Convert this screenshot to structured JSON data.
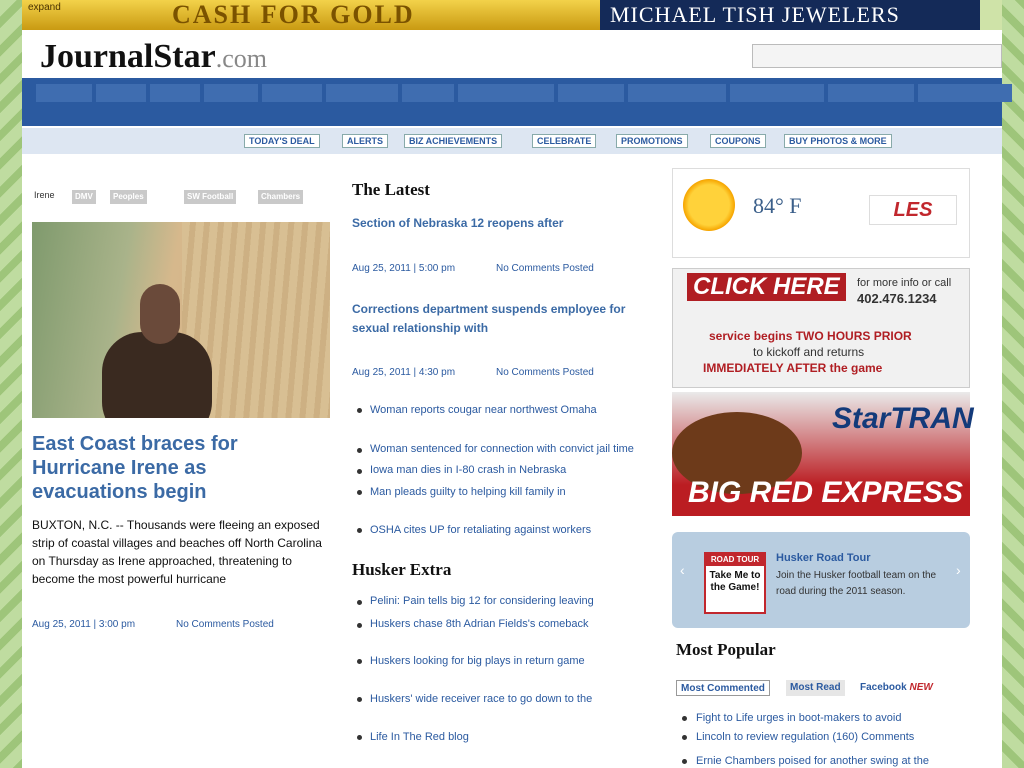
{
  "banner": {
    "expand": "expand",
    "ad_text": "CASH FOR GOLD",
    "jeweler": "MICHAEL TISH JEWELERS"
  },
  "logo": {
    "main": "JournalStar",
    "suffix": ".com"
  },
  "nav_sub": [
    "TODAY'S DEAL",
    "ALERTS",
    "BIZ ACHIEVEMENTS",
    "CELEBRATE",
    "PROMOTIONS",
    "COUPONS",
    "BUY PHOTOS & MORE"
  ],
  "tags": [
    "Irene",
    "DMV",
    "Peoples",
    "SW Football",
    "Chambers"
  ],
  "main_story": {
    "headline": "East Coast braces for Hurricane Irene as evacuations begin",
    "body": "BUXTON, N.C. -- Thousands were fleeing an exposed strip of coastal villages and beaches off North Carolina on Thursday as Irene approached, threatening to become the most powerful hurricane",
    "date": "Aug 25, 2011 | 3:00 pm",
    "comments": "No Comments Posted"
  },
  "latest": {
    "heading": "The Latest",
    "story1": {
      "title": "Section of Nebraska 12 reopens after",
      "date": "Aug 25, 2011 | 5:00 pm",
      "comments": "No Comments Posted"
    },
    "story2": {
      "title": "Corrections department suspends employee for sexual relationship with",
      "date": "Aug 25, 2011 | 4:30 pm",
      "comments": "No Comments Posted"
    },
    "links": [
      "Woman reports cougar near northwest Omaha",
      "Woman sentenced for connection with convict jail time",
      "Iowa man dies in I-80 crash in Nebraska",
      "Man pleads guilty to helping kill family in",
      "OSHA cites UP for retaliating against workers"
    ]
  },
  "huskers": {
    "heading": "Husker Extra",
    "links": [
      "Pelini: Pain tells big 12 for considering leaving",
      "Huskers chase 8th Adrian Fields's comeback",
      "Huskers looking for big plays in return game",
      "Huskers' wide receiver race to go down to the",
      "Life In The Red blog"
    ]
  },
  "weather": {
    "temp": "84° F",
    "sponsor": "LES"
  },
  "bus_ad": {
    "click": "CLICK HERE",
    "info": "for more info or call",
    "phone": "402.476.1234",
    "line1": "service begins TWO HOURS PRIOR",
    "line2": "to kickoff and returns",
    "line3": "IMMEDIATELY AFTER the game",
    "brand": "StarTRAN",
    "express": "BIG RED EXPRESS"
  },
  "promo": {
    "badge": "ROAD TOUR",
    "take": "Take Me to the Game!",
    "title": "Husker Road Tour",
    "desc": "Join the Husker football team on the road during the 2011 season."
  },
  "most_popular": {
    "heading": "Most Popular",
    "tabs": [
      "Most Commented",
      "Most Read",
      "Facebook"
    ],
    "new_badge": "NEW",
    "items": [
      "Fight to Life urges in boot-makers to avoid",
      "Lincoln to review regulation (160) Comments",
      "Ernie Chambers poised for another swing at the"
    ]
  },
  "colors": {
    "nav": "#2b5aa0",
    "link": "#2b5aa0",
    "headline": "#3b6aa5",
    "accent_red": "#bb1d22",
    "gold": "#d4a62a"
  }
}
